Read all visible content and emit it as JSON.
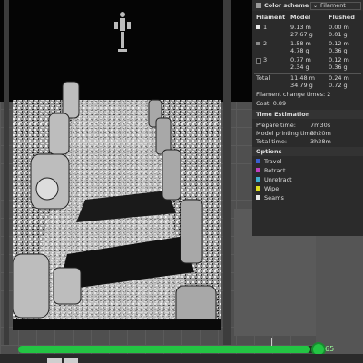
{
  "panel": {
    "title": "Color scheme",
    "scheme_select": "Filament",
    "columns": {
      "filament": "Filament",
      "model": "Model",
      "flushed": "Flushed"
    },
    "filaments": [
      {
        "id": "1",
        "color": "#e8e8e8",
        "model_len": "9.13 m",
        "model_wt": "27.67 g",
        "flush_len": "0.00 m",
        "flush_wt": "0.01 g"
      },
      {
        "id": "2",
        "color": "#8a8a8a",
        "model_len": "1.58 m",
        "model_wt": "4.78 g",
        "flush_len": "0.12 m",
        "flush_wt": "0.36 g"
      },
      {
        "id": "3",
        "color": "#1a1a1a",
        "model_len": "0.77 m",
        "model_wt": "2.34 g",
        "flush_len": "0.12 m",
        "flush_wt": "0.36 g"
      }
    ],
    "total": {
      "label": "Total",
      "model_len": "11.48 m",
      "model_wt": "34.79 g",
      "flush_len": "0.24 m",
      "flush_wt": "0.72 g"
    },
    "change_times": "Filament change times: 2",
    "cost": "Cost: 0.89",
    "time_estimation": {
      "title": "Time Estimation",
      "prepare_label": "Prepare time:",
      "prepare": "7m30s",
      "model_label": "Model printing time:",
      "model": "3h20m",
      "total_label": "Total time:",
      "total": "3h28m"
    },
    "options": {
      "title": "Options",
      "items": [
        {
          "label": "Travel",
          "color": "#3a5fd0"
        },
        {
          "label": "Retract",
          "color": "#c040c0"
        },
        {
          "label": "Unretract",
          "color": "#40b0d0"
        },
        {
          "label": "Wipe",
          "color": "#e0e020"
        },
        {
          "label": "Seams",
          "color": "#e8e8e8"
        }
      ]
    }
  },
  "slider": {
    "progress": 0.97,
    "tag": "65",
    "color": "#23c443"
  }
}
